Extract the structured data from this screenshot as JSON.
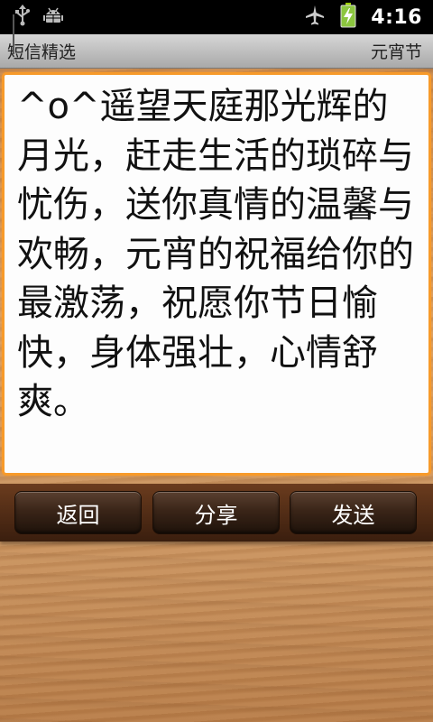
{
  "status_bar": {
    "time": "4:16",
    "icons": [
      "usb-icon",
      "android-debug-icon",
      "airplane-mode-icon",
      "battery-charging-icon"
    ]
  },
  "header": {
    "title": "短信精选",
    "category": "元宵节"
  },
  "message": {
    "text": "^o^遥望天庭那光辉的月光，赶走生活的琐碎与忧伤，送你真情的温馨与欢畅，元宵的祝福给你的最激荡，祝愿你节日愉快，身体强壮，心情舒爽。"
  },
  "buttons": {
    "back": "返回",
    "share": "分享",
    "send": "发送"
  },
  "colors": {
    "focus_border": "#f79a2a",
    "button_bar": "#4a2814"
  }
}
